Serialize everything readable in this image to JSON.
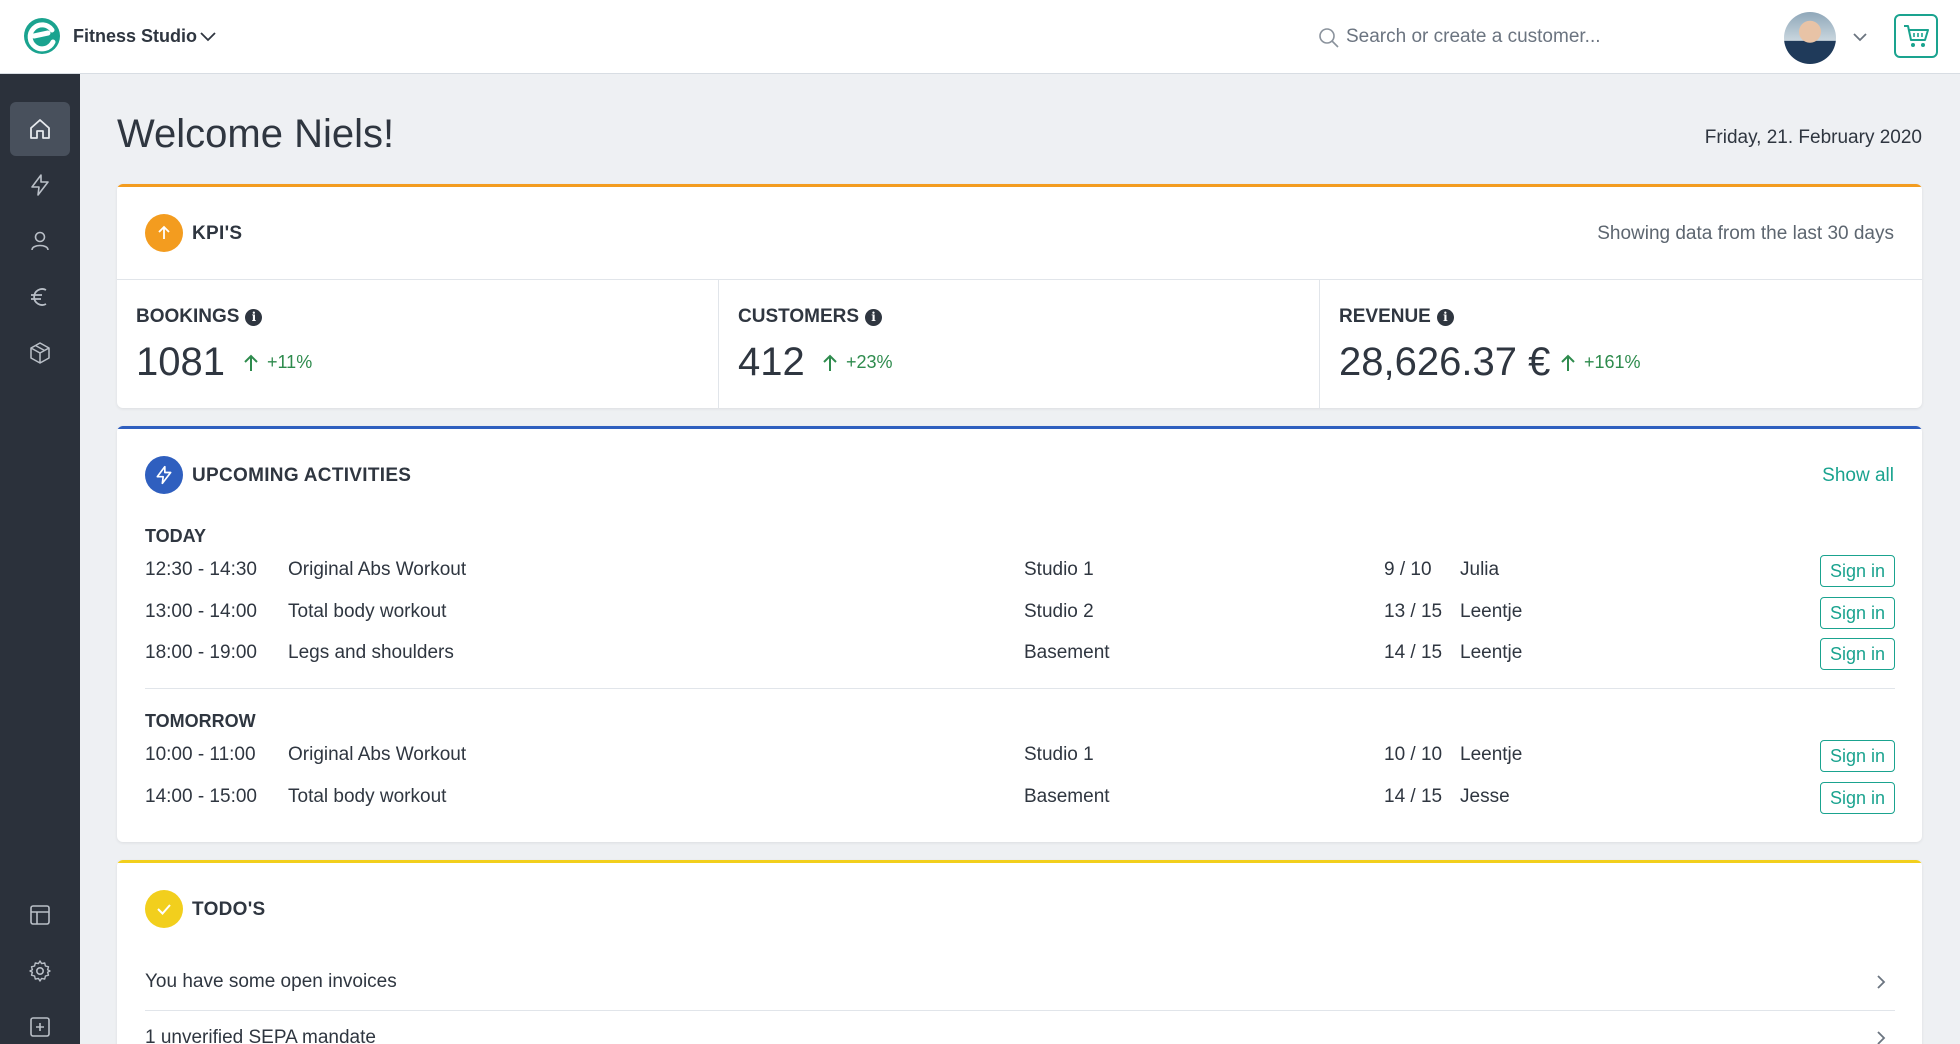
{
  "header": {
    "studio_name": "Fitness Studio",
    "search_placeholder": "Search or create a customer..."
  },
  "colors": {
    "brand_teal": "#1aa38f",
    "kpi_accent": "#f39c1f",
    "activities_accent": "#2f5fbf",
    "todos_accent": "#f2cf1d",
    "positive_change": "#2e8b4d",
    "sidebar_bg": "#2b313b"
  },
  "sidebar": {
    "items": [
      {
        "icon": "home-icon",
        "active": true
      },
      {
        "icon": "lightning-icon",
        "active": false
      },
      {
        "icon": "user-icon",
        "active": false
      },
      {
        "icon": "euro-icon",
        "active": false
      },
      {
        "icon": "box-icon",
        "active": false
      },
      {
        "icon": "layout-icon",
        "active": false
      },
      {
        "icon": "gear-icon",
        "active": false
      },
      {
        "icon": "plus-square-icon",
        "active": false
      }
    ]
  },
  "page": {
    "title": "Welcome Niels!",
    "date": "Friday, 21. February 2020"
  },
  "kpis": {
    "title": "KPI'S",
    "subtitle": "Showing data from the last 30 days",
    "items": [
      {
        "label": "BOOKINGS",
        "value": "1081",
        "change": "+11%"
      },
      {
        "label": "CUSTOMERS",
        "value": "412",
        "change": "+23%"
      },
      {
        "label": "REVENUE",
        "value": "28,626.37 €",
        "change": "+161%"
      }
    ]
  },
  "activities": {
    "title": "UPCOMING ACTIVITIES",
    "show_all": "Show all",
    "sign_in_label": "Sign in",
    "groups": [
      {
        "label": "TODAY",
        "rows": [
          {
            "time": "12:30 - 14:30",
            "name": "Original Abs Workout",
            "room": "Studio 1",
            "capacity": "9 / 10",
            "trainer": "Julia"
          },
          {
            "time": "13:00 - 14:00",
            "name": "Total body workout",
            "room": "Studio 2",
            "capacity": "13 / 15",
            "trainer": "Leentje"
          },
          {
            "time": "18:00 - 19:00",
            "name": "Legs and shoulders",
            "room": "Basement",
            "capacity": "14 / 15",
            "trainer": "Leentje"
          }
        ]
      },
      {
        "label": "TOMORROW",
        "rows": [
          {
            "time": "10:00 - 11:00",
            "name": "Original Abs Workout",
            "room": "Studio 1",
            "capacity": "10 / 10",
            "trainer": "Leentje"
          },
          {
            "time": "14:00 - 15:00",
            "name": "Total body workout",
            "room": "Basement",
            "capacity": "14 / 15",
            "trainer": "Jesse"
          }
        ]
      }
    ]
  },
  "todos": {
    "title": "TODO'S",
    "items": [
      {
        "text": "You have some open invoices"
      },
      {
        "text": "1 unverified SEPA mandate"
      }
    ]
  }
}
